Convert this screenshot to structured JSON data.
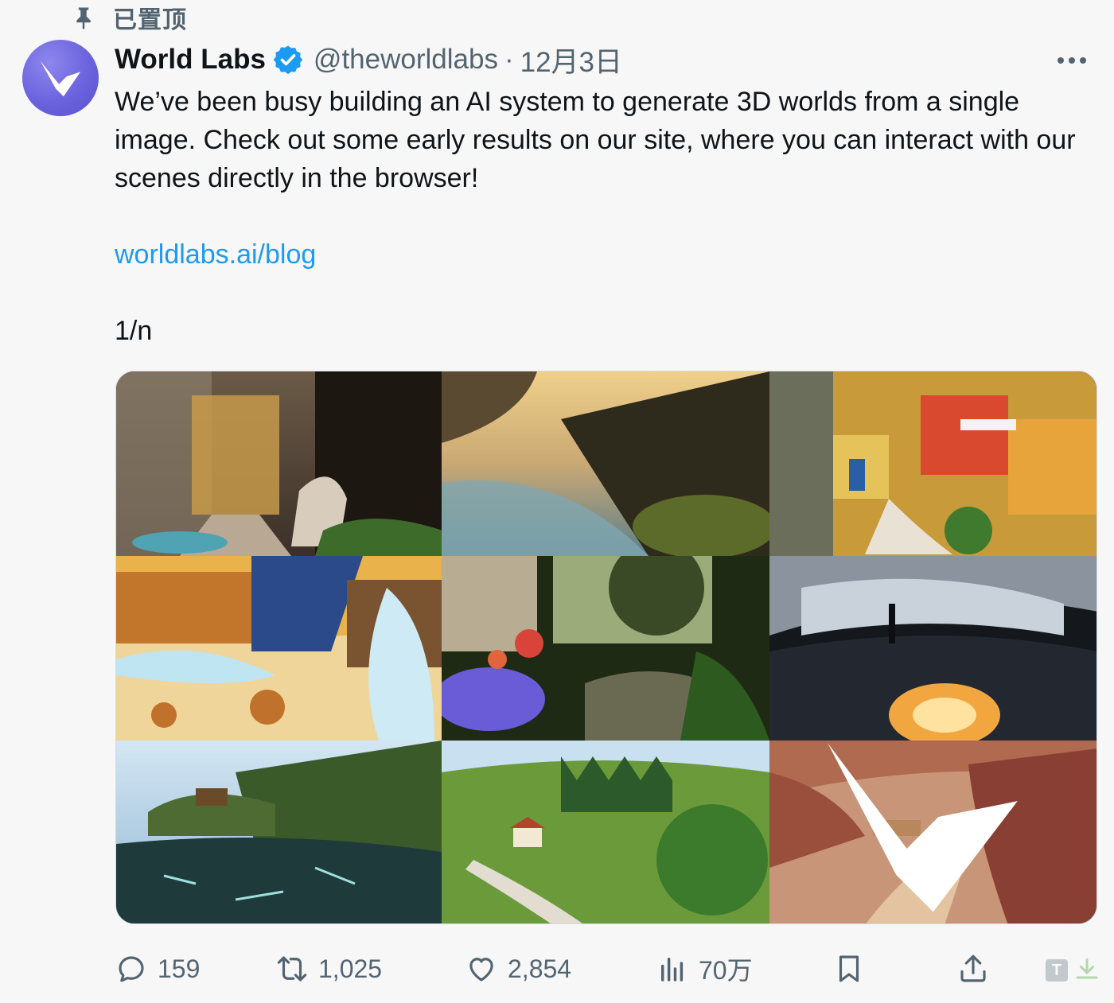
{
  "pinned": {
    "label": "已置顶",
    "icon": "pin-icon"
  },
  "author": {
    "name": "World Labs",
    "handle": "@theworldlabs",
    "separator": "·",
    "date": "12月3日",
    "verified": true,
    "avatar_color": "#6b63dd"
  },
  "tweet": {
    "text": "We’ve been busy building an AI system to generate 3D worlds from a single image. Check out some early results on our site, where you can interact with our scenes directly in the browser!",
    "link": "worldlabs.ai/blog",
    "thread_marker": "1/n"
  },
  "media": {
    "tiles": [
      "fantasy-palace-staircase",
      "misty-river-sunrise",
      "colorful-hillside-village",
      "cartoon-icy-ruins",
      "flower-garden-path",
      "futuristic-white-hall",
      "lake-cabin-island",
      "green-valley-village",
      "desert-canyon-town"
    ]
  },
  "actions": {
    "reply": {
      "count": "159",
      "icon": "reply-icon"
    },
    "repost": {
      "count": "1,025",
      "icon": "repost-icon"
    },
    "like": {
      "count": "2,854",
      "icon": "heart-icon"
    },
    "views": {
      "count": "70万",
      "icon": "views-icon"
    },
    "bookmark": {
      "icon": "bookmark-icon"
    },
    "share": {
      "icon": "share-icon"
    }
  },
  "colors": {
    "link": "#1d9bf0",
    "muted": "#536471",
    "text": "#0f1419",
    "verified": "#1d9bf0"
  }
}
